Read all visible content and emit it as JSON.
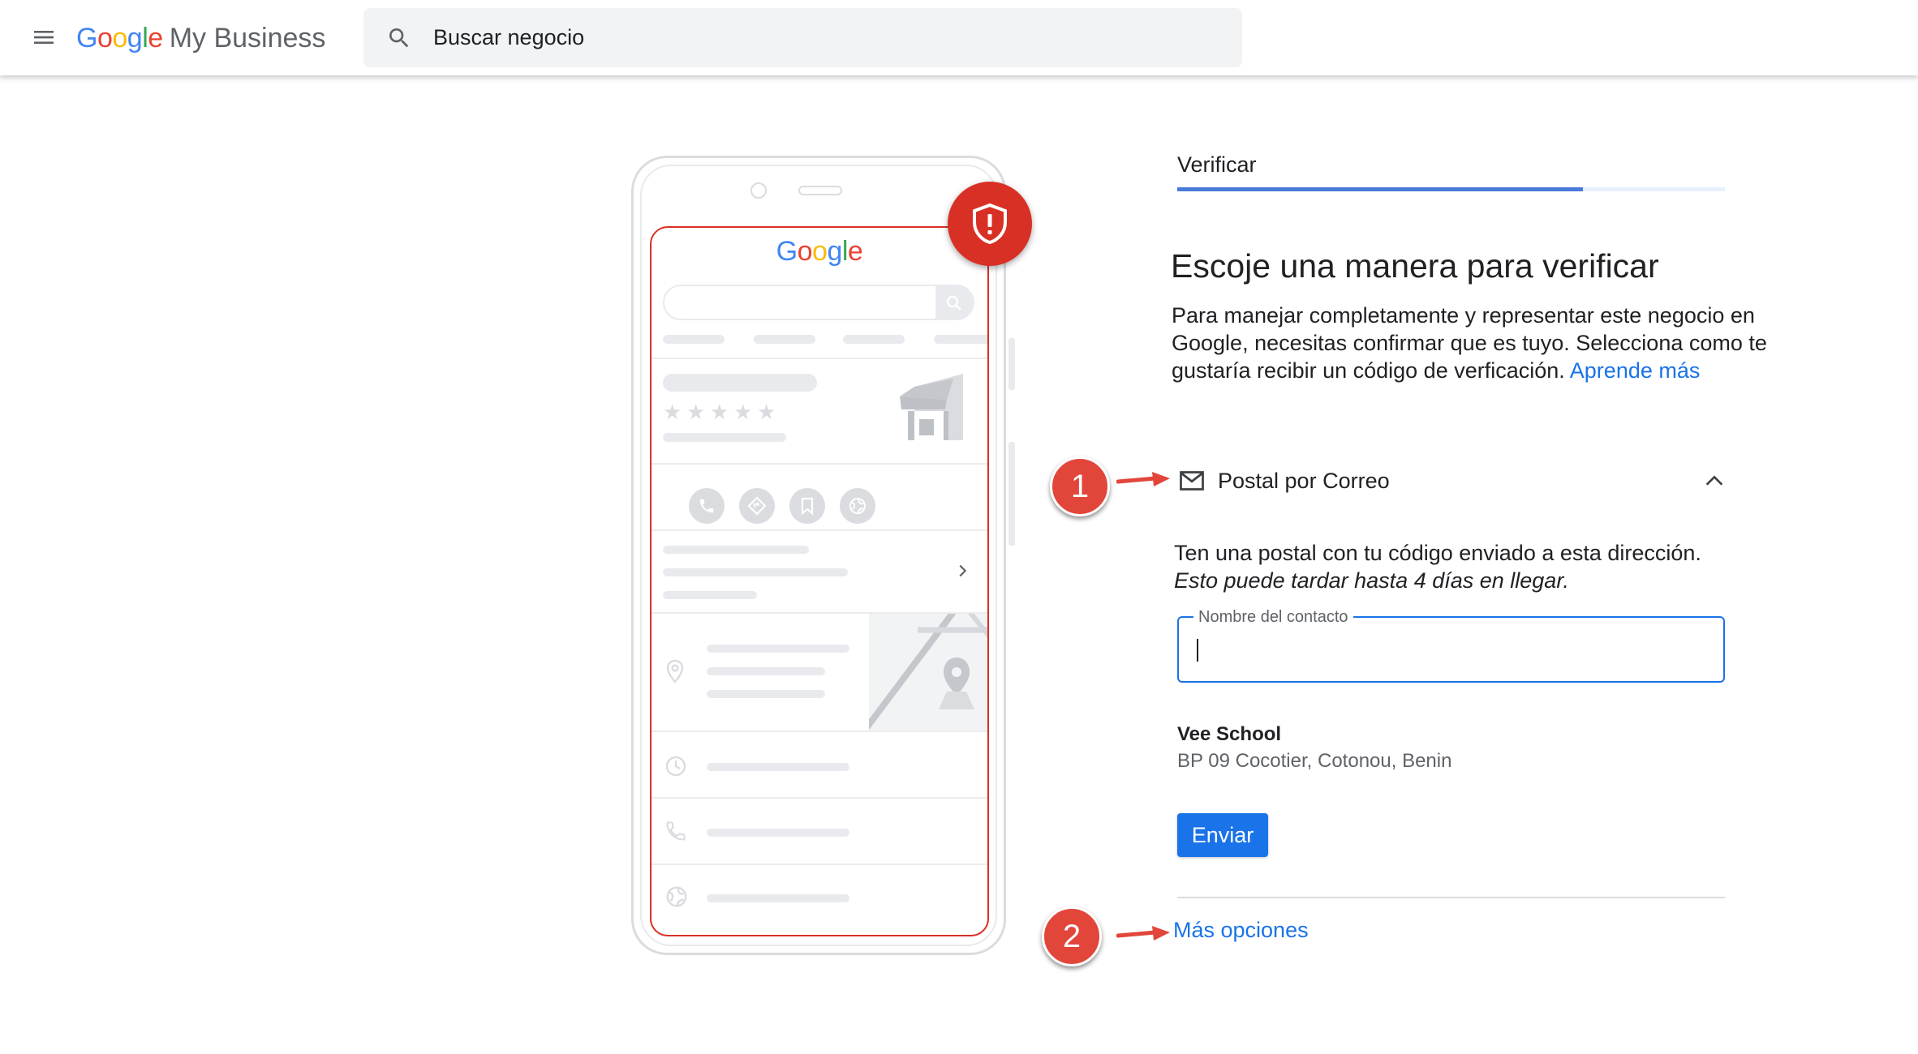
{
  "header": {
    "brand_google": "Google",
    "brand_product": "My Business",
    "search_placeholder": "Buscar negocio"
  },
  "illustration": {
    "logo_text": "Google"
  },
  "verify": {
    "step_label": "Verificar",
    "progress": 0.74,
    "heading": "Escoje una manera para verificar",
    "intro_text": "Para manejar completamente y representar este negocio en Google, necesitas confirmar que es tuyo. Selecciona como te gustaría recibir un código de verficación.",
    "learn_more": "Aprende más"
  },
  "option": {
    "label": "Postal por Correo",
    "icon": "mail-icon",
    "expanded": true,
    "instruction": "Ten una postal con tu código enviado a esta dirección.",
    "note": "Esto puede tardar hasta 4 días en llegar."
  },
  "contact_field": {
    "label": "Nombre del contacto",
    "value": ""
  },
  "business": {
    "name": "Vee School",
    "address": "BP 09 Cocotier, Cotonou, Benin"
  },
  "actions": {
    "send_label": "Enviar",
    "more_options": "Más opciones"
  },
  "annotations": {
    "marker_1": "1",
    "marker_2": "2"
  },
  "colors": {
    "accent": "#1a73e8",
    "alert_red": "#d93025",
    "marker_red": "#e2463a"
  }
}
